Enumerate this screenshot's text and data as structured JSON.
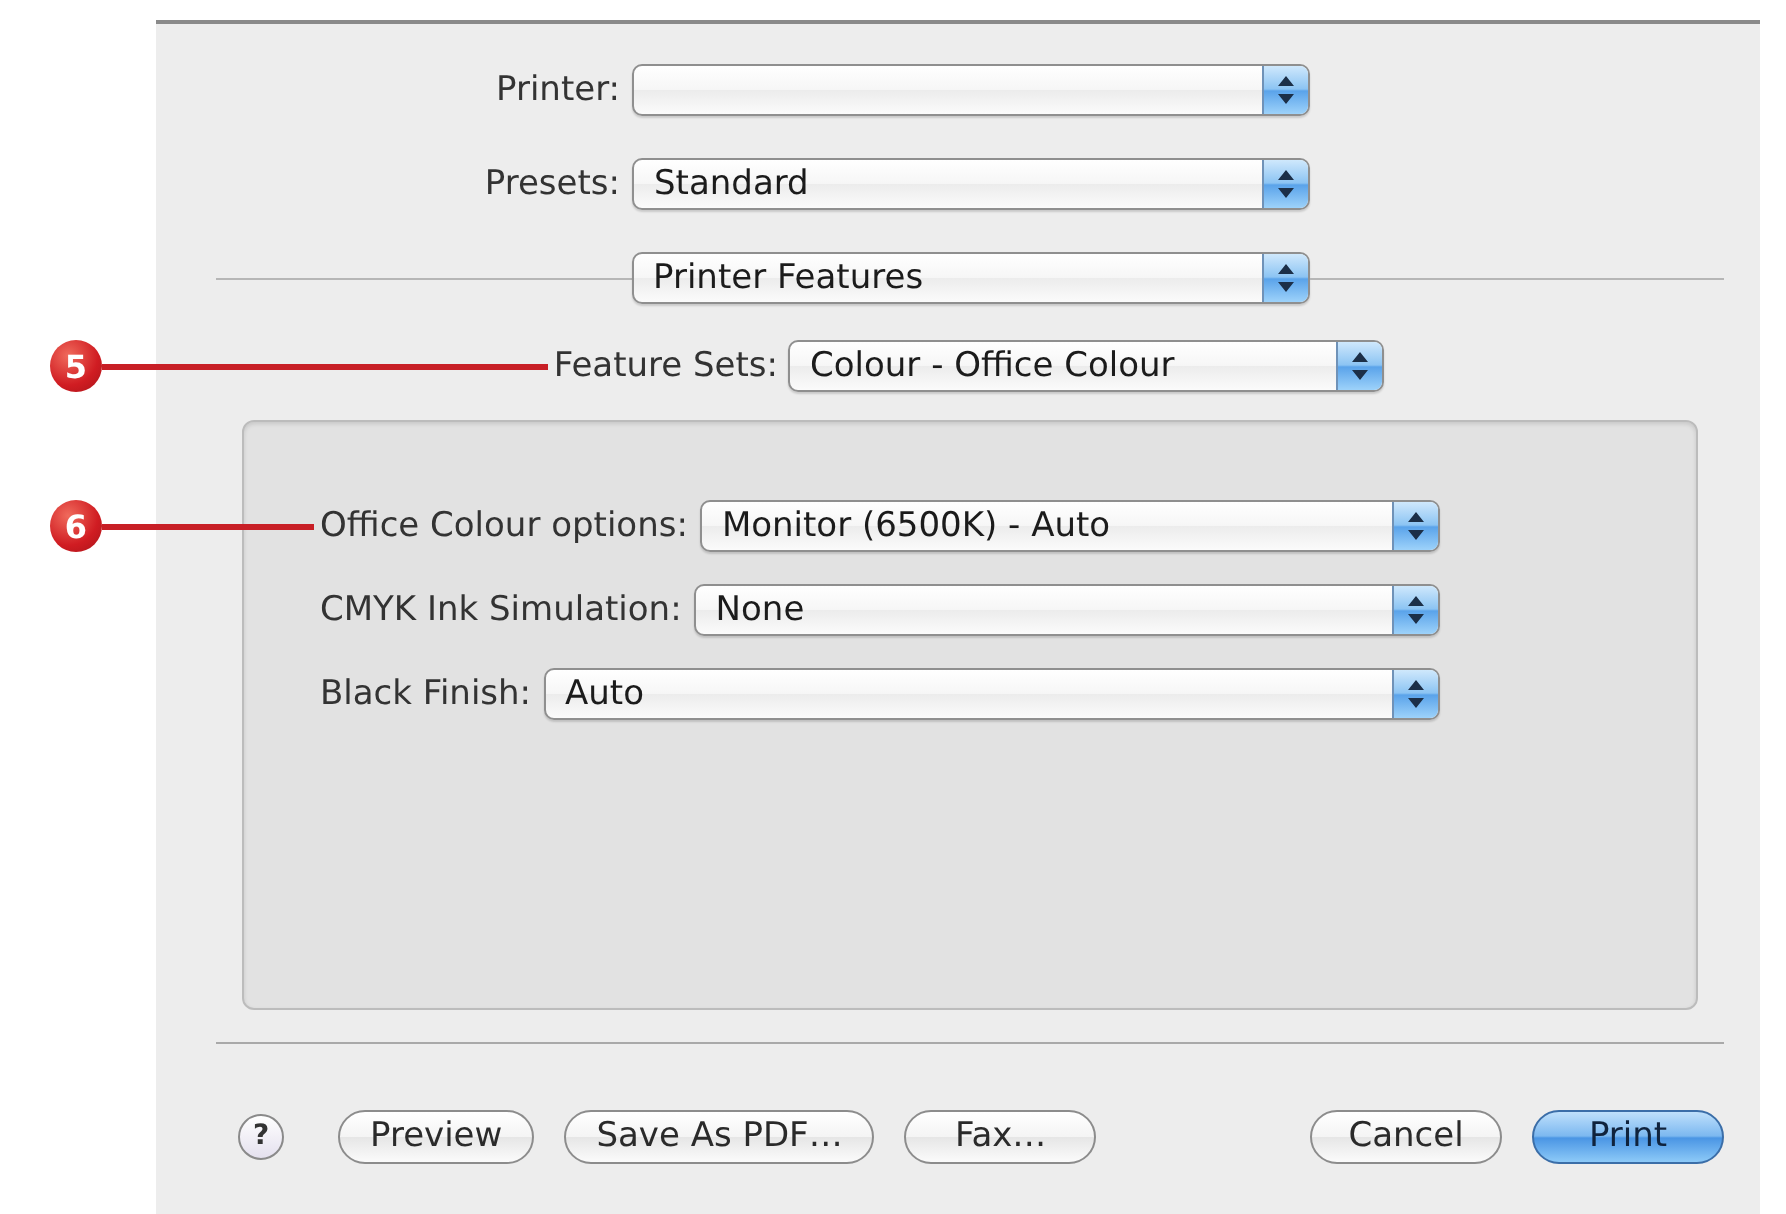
{
  "dialog": {
    "printer": {
      "label": "Printer:"
    },
    "presets": {
      "label": "Presets:",
      "value": "Standard"
    },
    "pane_menu": {
      "value": "Printer Features"
    },
    "feature_sets": {
      "label": "Feature Sets:",
      "value": "Colour - Office Colour",
      "callout": "5"
    },
    "options": [
      {
        "label": "Office Colour options:",
        "value": "Monitor (6500K) - Auto",
        "callout": "6"
      },
      {
        "label": "CMYK Ink Simulation:",
        "value": "None"
      },
      {
        "label": "Black Finish:",
        "value": "Auto"
      }
    ],
    "left_buttons": [
      {
        "kind": "help",
        "label": "?",
        "default": false
      },
      {
        "kind": "push",
        "label": "Preview",
        "default": false
      },
      {
        "kind": "push",
        "label": "Save As PDF…",
        "default": false
      },
      {
        "kind": "push",
        "label": "Fax…",
        "default": false
      }
    ],
    "right_buttons": [
      {
        "kind": "push",
        "label": "Cancel",
        "default": false
      },
      {
        "kind": "push",
        "label": "Print",
        "default": true
      }
    ]
  }
}
